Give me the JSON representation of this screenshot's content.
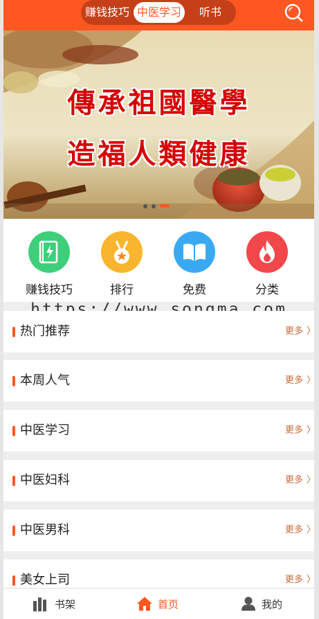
{
  "header": {
    "tabs": [
      "赚钱技巧",
      "中医学习",
      "听书"
    ],
    "active_tab": 1,
    "search_icon": "search-icon",
    "accent": "#ff5722"
  },
  "banner": {
    "line1": "傳承祖國醫學",
    "line2": "造福人類健康",
    "slide_count": 3,
    "active_slide": 2
  },
  "quick_nav": [
    {
      "label": "赚钱技巧",
      "icon": "book-lightning-icon",
      "color": "#3ecf7b"
    },
    {
      "label": "排行",
      "icon": "medal-icon",
      "color": "#f9b52d"
    },
    {
      "label": "免费",
      "icon": "open-book-icon",
      "color": "#3aa9f4"
    },
    {
      "label": "分类",
      "icon": "flame-icon",
      "color": "#f2474b"
    }
  ],
  "watermark": "https://www.songma.com",
  "sections": [
    {
      "title": "热门推荐",
      "more": "更多"
    },
    {
      "title": "本周人气",
      "more": "更多"
    },
    {
      "title": "中医学习",
      "more": "更多"
    },
    {
      "title": "中医妇科",
      "more": "更多"
    },
    {
      "title": "中医男科",
      "more": "更多"
    },
    {
      "title": "美女上司",
      "more": "更多"
    }
  ],
  "footer": {
    "tabs": [
      {
        "label": "书架",
        "icon": "bookshelf-icon"
      },
      {
        "label": "首页",
        "icon": "home-icon"
      },
      {
        "label": "我的",
        "icon": "user-icon"
      }
    ],
    "active_tab": 1
  }
}
